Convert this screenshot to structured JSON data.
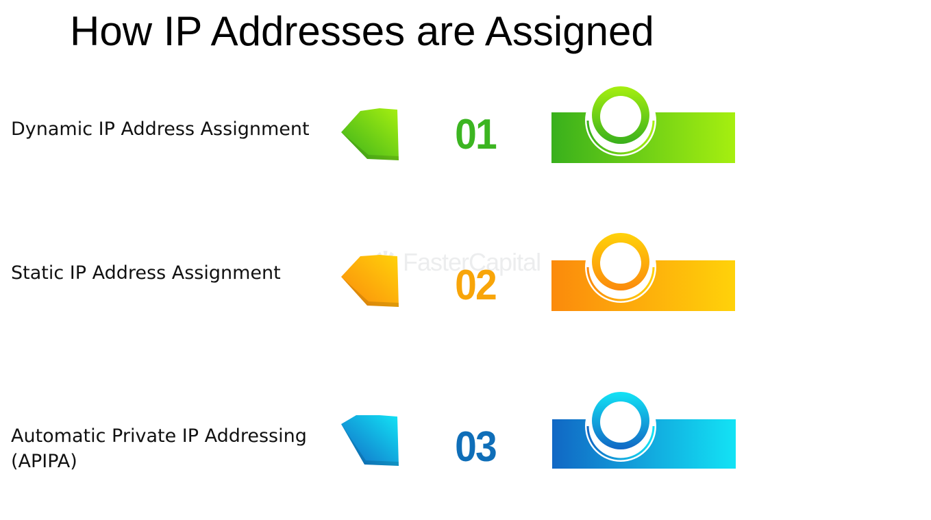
{
  "title": "How IP Addresses are Assigned",
  "watermark": "FasterCapital",
  "steps": [
    {
      "number": "01",
      "label_lines": [
        "Dynamic IP Address Assignment",
        ""
      ],
      "color_dark": "#39b01c",
      "color_light": "#a6ef10",
      "text_color": "#3cb521"
    },
    {
      "number": "02",
      "label_lines": [
        "Static IP Address Assignment",
        ""
      ],
      "color_dark": "#fb8a0c",
      "color_light": "#ffd20a",
      "text_color": "#f8a509"
    },
    {
      "number": "03",
      "label_lines": [
        "Automatic Private IP Addressing",
        "(APIPA)"
      ],
      "color_dark": "#1167c4",
      "color_light": "#13e3f5",
      "text_color": "#0f6eb8"
    }
  ]
}
